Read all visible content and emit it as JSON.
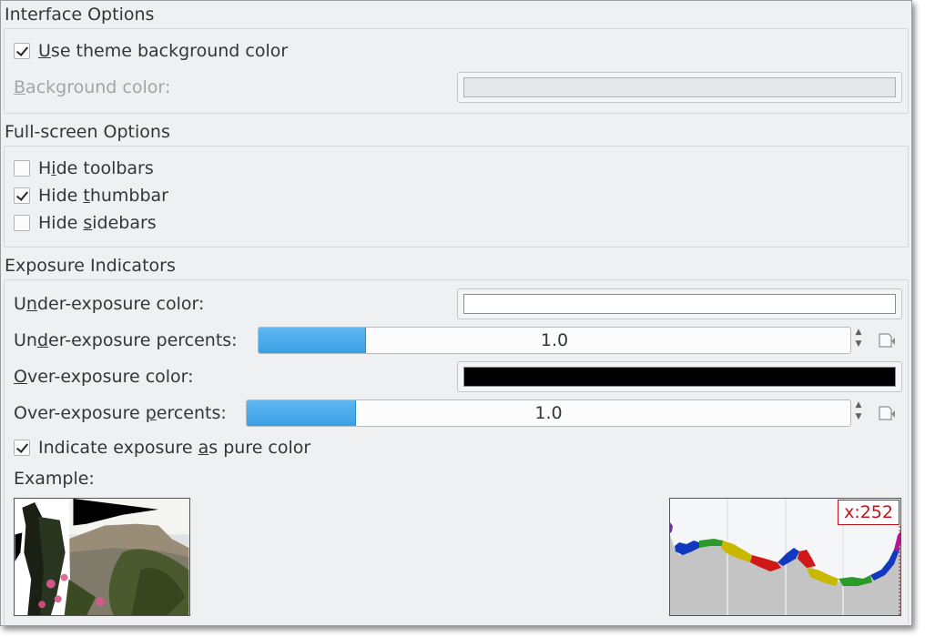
{
  "interface": {
    "title": "Interface Options",
    "use_theme_bg": {
      "label_pre": "",
      "label_key": "U",
      "label_post": "se theme background color",
      "checked": true
    },
    "bg_color": {
      "label_pre": "",
      "label_key": "B",
      "label_post": "ackground color:",
      "swatch": "#e6e7e8"
    }
  },
  "fullscreen": {
    "title": "Full-screen Options",
    "hide_toolbars": {
      "label_pre": "H",
      "label_key": "i",
      "label_post": "de toolbars",
      "checked": false
    },
    "hide_thumbbar": {
      "label_pre": "Hide ",
      "label_key": "t",
      "label_post": "humbbar",
      "checked": true
    },
    "hide_sidebars": {
      "label_pre": "Hide ",
      "label_key": "s",
      "label_post": "idebars",
      "checked": false
    }
  },
  "exposure": {
    "title": "Exposure Indicators",
    "under_color": {
      "label_pre": "U",
      "label_key": "n",
      "label_post": "der-exposure color:",
      "swatch": "#ffffff"
    },
    "under_percent": {
      "label_pre": "Un",
      "label_key": "d",
      "label_post": "er-exposure percents:",
      "value": "1.0",
      "fraction": 0.18
    },
    "over_color": {
      "label_pre": "",
      "label_key": "O",
      "label_post": "ver-exposure color:",
      "swatch": "#000000"
    },
    "over_percent": {
      "label_pre": "Over-exposure ",
      "label_key": "p",
      "label_post": "ercents:",
      "value": "1.0",
      "fraction": 0.18
    },
    "pure_color": {
      "label_pre": "Indicate exposure ",
      "label_key": "a",
      "label_post": "s pure color",
      "checked": true
    },
    "example_label": "Example:",
    "histogram_x": "x:252"
  }
}
